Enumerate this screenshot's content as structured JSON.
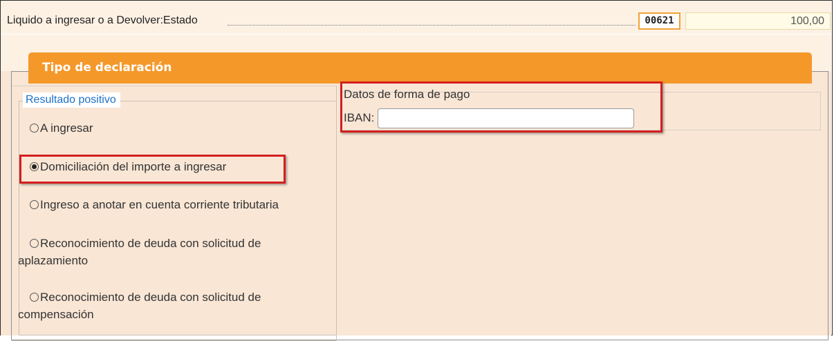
{
  "top_row": {
    "label": "Liquido a ingresar o a Devolver:Estado",
    "code": "00621",
    "value": "100,00"
  },
  "section": {
    "title": "Tipo de declaración"
  },
  "resultado": {
    "legend": "Resultado positivo",
    "options": [
      {
        "label": "A ingresar",
        "checked": false
      },
      {
        "label": "Domiciliación del importe a ingresar",
        "checked": true
      },
      {
        "label": "Ingreso a anotar en cuenta corriente tributaria",
        "checked": false
      },
      {
        "label": "Reconocimiento de deuda con solicitud de",
        "label_line2": "aplazamiento",
        "checked": false
      },
      {
        "label": "Reconocimiento de deuda con solicitud de",
        "label_line2": "compensación",
        "checked": false
      }
    ]
  },
  "pago": {
    "title": "Datos de forma de pago",
    "iban_label": "IBAN:",
    "iban_value": ""
  },
  "colors": {
    "accent": "#f5982a",
    "highlight": "#d41e1e",
    "legend": "#1e6fc7",
    "panel_bg": "#f9e6d5"
  }
}
